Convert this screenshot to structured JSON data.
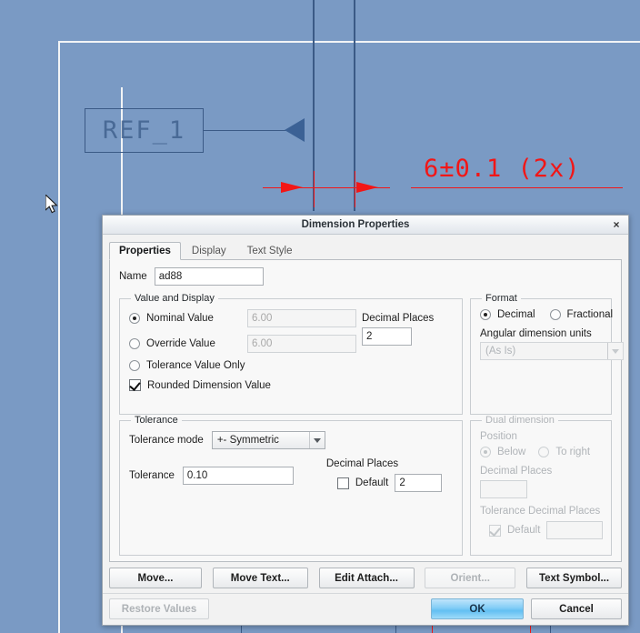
{
  "cad": {
    "ref_balloon_label": "REF_1",
    "dimension_text": "6±0.1 (2x)",
    "cursor_icon": "arrow-cursor-icon",
    "colors": {
      "background": "#7a9ac4",
      "geometry_blue": "#3b5a86",
      "dimension_red": "#f21616",
      "sheet_border_white": "#f2f4f6"
    }
  },
  "dialog": {
    "title": "Dimension Properties",
    "close_label": "×",
    "tabs": [
      {
        "label": "Properties",
        "active": true
      },
      {
        "label": "Display",
        "active": false
      },
      {
        "label": "Text Style",
        "active": false
      }
    ],
    "name_field": {
      "label": "Name",
      "value": "ad88"
    },
    "value_and_display": {
      "legend": "Value and Display",
      "options": [
        {
          "label": "Nominal Value",
          "selected": true,
          "field_value": "6.00",
          "field_enabled": false
        },
        {
          "label": "Override Value",
          "selected": false,
          "field_value": "6.00",
          "field_enabled": false
        },
        {
          "label": "Tolerance Value Only",
          "selected": false
        }
      ],
      "rounded_dimension_value": {
        "label": "Rounded Dimension Value",
        "checked": true
      },
      "decimal_places": {
        "label": "Decimal Places",
        "value": "2"
      }
    },
    "format": {
      "legend": "Format",
      "options": [
        {
          "label": "Decimal",
          "selected": true
        },
        {
          "label": "Fractional",
          "selected": false
        }
      ],
      "angular_units": {
        "label": "Angular dimension units",
        "value": "(As Is)",
        "enabled": false
      }
    },
    "tolerance": {
      "legend": "Tolerance",
      "mode_label": "Tolerance mode",
      "mode_value": "+- Symmetric",
      "value_label": "Tolerance",
      "value": "0.10",
      "decimal_places_label": "Decimal Places",
      "default_label": "Default",
      "default_checked": false,
      "decimal_places_value": "2"
    },
    "dual_dimension": {
      "legend": "Dual dimension",
      "enabled": false,
      "position_label": "Position",
      "position_options": [
        {
          "label": "Below",
          "selected": true
        },
        {
          "label": "To right",
          "selected": false
        }
      ],
      "decimal_places_label": "Decimal Places",
      "decimal_places_value": "",
      "tolerance_decimal_places_label": "Tolerance Decimal Places",
      "tolerance_default_label": "Default",
      "tolerance_default_checked": true,
      "tolerance_decimal_places_value": ""
    },
    "buttons": {
      "move": "Move...",
      "move_text": "Move Text...",
      "edit_attach": "Edit Attach...",
      "orient": "Orient...",
      "orient_enabled": false,
      "text_symbol": "Text Symbol...",
      "restore_values": "Restore Values",
      "restore_values_enabled": false,
      "ok": "OK",
      "cancel": "Cancel"
    }
  }
}
